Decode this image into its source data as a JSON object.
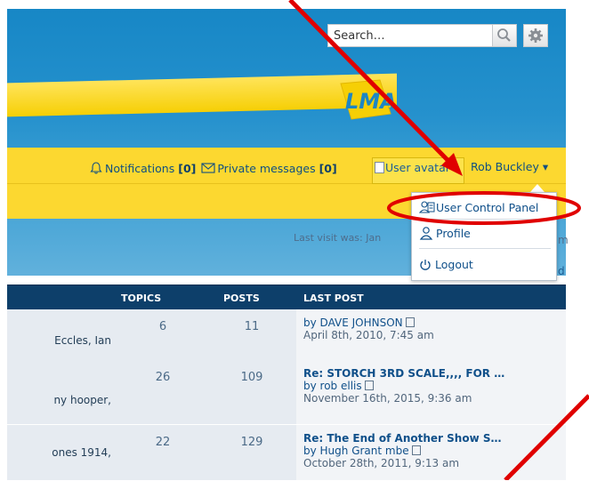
{
  "header": {
    "search_placeholder": "Search…",
    "logo_text": "LMA"
  },
  "nav": {
    "notifications_label": "Notifications",
    "notifications_count": "[0]",
    "private_messages_label": "Private messages",
    "private_messages_count": "[0]",
    "avatar_alt": "User avatar",
    "username": "Rob Buckley ▾"
  },
  "dropdown": {
    "items": [
      {
        "label": "User Control Panel"
      },
      {
        "label": "Profile"
      },
      {
        "label": "Logout"
      }
    ]
  },
  "info": {
    "last_visit": "Last visit was: Jan",
    "ghost_m": "m",
    "ghost_d": "d"
  },
  "table": {
    "headers": [
      "TOPICS",
      "POSTS",
      "LAST POST"
    ],
    "rows": [
      {
        "moderators": "Eccles, Ian",
        "topics": "6",
        "posts": "11",
        "last_title": "",
        "last_by": "by DAVE JOHNSON",
        "last_date": "April 8th, 2010, 7:45 am"
      },
      {
        "moderators": "ny hooper,",
        "topics": "26",
        "posts": "109",
        "last_title": "Re: STORCH 3RD SCALE,,,, FOR …",
        "last_by": "by rob ellis",
        "last_date": "November 16th, 2015, 9:36 am"
      },
      {
        "moderators": "ones 1914,",
        "topics": "22",
        "posts": "129",
        "last_title": "Re: The End of Another Show S…",
        "last_by": "by Hugh Grant mbe",
        "last_date": "October 28th, 2011, 9:13 am"
      }
    ]
  },
  "colors": {
    "header_blue": "#1787c6",
    "navbar_yellow": "#fcd830",
    "table_head": "#0d3f6a",
    "annotation_red": "#e00000"
  }
}
